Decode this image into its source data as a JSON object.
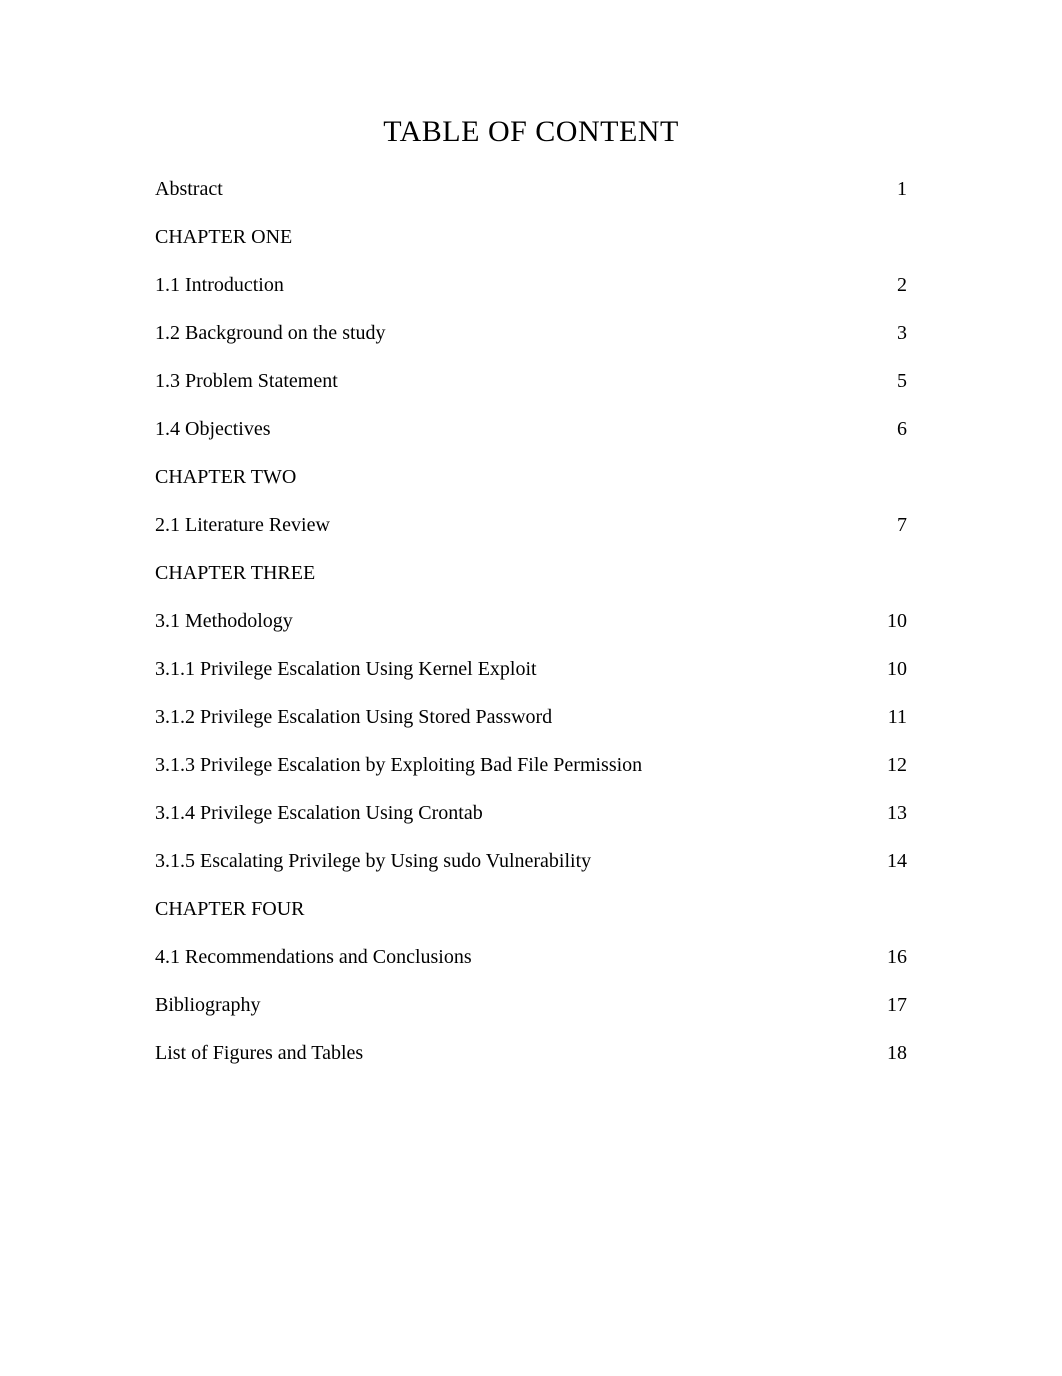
{
  "title": "TABLE OF CONTENT",
  "entries": [
    {
      "label": "Abstract",
      "page": "1",
      "type": "entry"
    },
    {
      "label": "CHAPTER ONE",
      "page": "",
      "type": "chapter"
    },
    {
      "label": "1.1 Introduction",
      "page": "2",
      "type": "entry"
    },
    {
      "label": "1.2 Background on the study",
      "page": "3",
      "type": "entry"
    },
    {
      "label": "1.3 Problem Statement",
      "page": "5",
      "type": "entry"
    },
    {
      "label": "1.4 Objectives",
      "page": "6",
      "type": "entry"
    },
    {
      "label": "CHAPTER TWO",
      "page": "",
      "type": "chapter"
    },
    {
      "label": "2.1 Literature Review",
      "page": "7",
      "type": "entry"
    },
    {
      "label": "CHAPTER THREE",
      "page": "",
      "type": "chapter"
    },
    {
      "label": "3.1 Methodology",
      "page": "10",
      "type": "entry"
    },
    {
      "label": "3.1.1 Privilege Escalation Using Kernel Exploit",
      "page": "10",
      "type": "entry"
    },
    {
      "label": "3.1.2 Privilege Escalation Using Stored Password",
      "page": "11",
      "type": "entry"
    },
    {
      "label": "3.1.3 Privilege Escalation by Exploiting Bad File Permission",
      "page": "12",
      "type": "entry"
    },
    {
      "label": "3.1.4 Privilege Escalation Using Crontab",
      "page": "13",
      "type": "entry"
    },
    {
      "label": "3.1.5 Escalating Privilege by Using sudo Vulnerability",
      "page": "14",
      "type": "entry"
    },
    {
      "label": "CHAPTER FOUR",
      "page": "",
      "type": "chapter"
    },
    {
      "label": "4.1 Recommendations and Conclusions",
      "page": "16",
      "type": "entry"
    },
    {
      "label": "Bibliography",
      "page": "17",
      "type": "entry"
    },
    {
      "label": "List of Figures and Tables",
      "page": "18",
      "type": "entry"
    }
  ]
}
